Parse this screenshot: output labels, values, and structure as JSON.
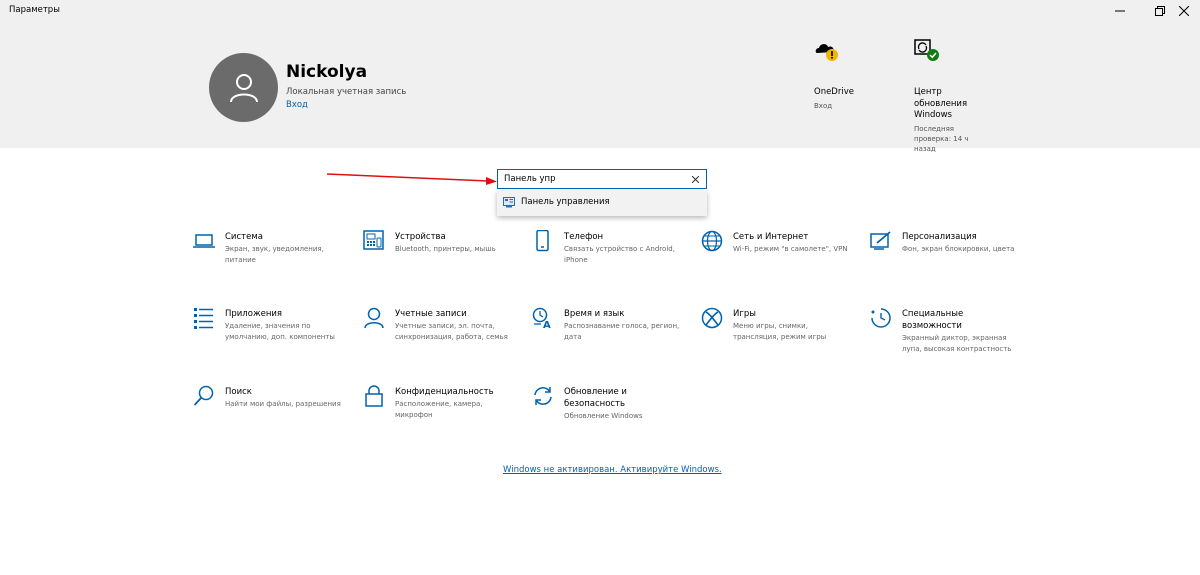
{
  "window": {
    "title": "Параметры"
  },
  "user": {
    "name": "Nickolya",
    "account_type": "Локальная учетная запись",
    "sign_in_link": "Вход"
  },
  "header_tiles": [
    {
      "title": "OneDrive",
      "subtitle": "Вход",
      "icon": "onedrive-warning-icon"
    },
    {
      "title": "Центр обновления Windows",
      "subtitle": "Последняя проверка: 14 ч назад",
      "icon": "windows-update-check-icon"
    }
  ],
  "search": {
    "value": "Панель упр",
    "suggestions": [
      {
        "label": "Панель управления",
        "icon": "control-panel-icon"
      }
    ]
  },
  "categories": [
    {
      "title": "Система",
      "desc": "Экран, звук, уведомления, питание",
      "icon": "laptop-icon"
    },
    {
      "title": "Устройства",
      "desc": "Bluetooth, принтеры, мышь",
      "icon": "devices-icon"
    },
    {
      "title": "Телефон",
      "desc": "Связать устройство с Android, iPhone",
      "icon": "phone-icon"
    },
    {
      "title": "Сеть и Интернет",
      "desc": "Wi-Fi, режим \"в самолете\", VPN",
      "icon": "globe-icon"
    },
    {
      "title": "Персонализация",
      "desc": "Фон, экран блокировки, цвета",
      "icon": "personalization-icon"
    },
    {
      "title": "Приложения",
      "desc": "Удаление, значения по умолчанию, доп. компоненты",
      "icon": "apps-list-icon"
    },
    {
      "title": "Учетные записи",
      "desc": "Учетные записи, эл. почта, синхронизация, работа, семья",
      "icon": "person-icon"
    },
    {
      "title": "Время и язык",
      "desc": "Распознавание голоса, регион, дата",
      "icon": "time-language-icon"
    },
    {
      "title": "Игры",
      "desc": "Меню игры, снимки, трансляция, режим игры",
      "icon": "xbox-icon"
    },
    {
      "title": "Специальные возможности",
      "desc": "Экранный диктор, экранная лупа, высокая контрастность",
      "icon": "accessibility-icon"
    },
    {
      "title": "Поиск",
      "desc": "Найти мои файлы, разрешения",
      "icon": "search-icon"
    },
    {
      "title": "Конфиденциальность",
      "desc": "Расположение, камера, микрофон",
      "icon": "lock-icon"
    },
    {
      "title": "Обновление и безопасность",
      "desc": "Обновление Windows",
      "icon": "update-sync-icon"
    }
  ],
  "activation_notice": "Windows не активирован. Активируйте Windows.",
  "colors": {
    "accent": "#0063b1",
    "header_bg": "#f0f0f0",
    "arrow": "#e01010",
    "warning": "#f3b600",
    "ok": "#107c10"
  }
}
